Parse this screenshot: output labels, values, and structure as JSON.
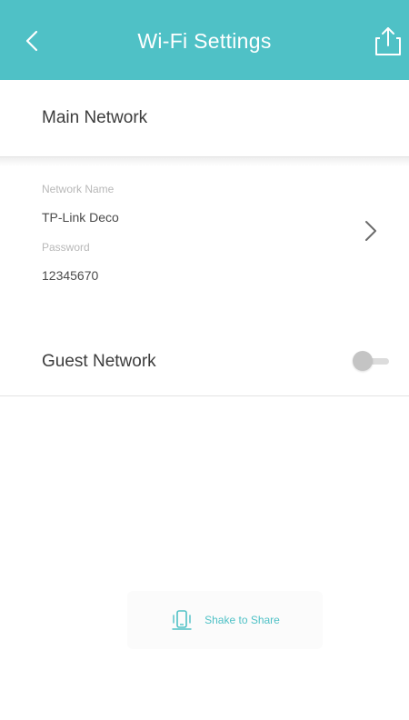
{
  "header": {
    "title": "Wi-Fi Settings",
    "back_icon": "chevron-left-icon",
    "share_icon": "share-icon",
    "color": "#4fc1c6"
  },
  "main_network": {
    "section_label": "Main Network",
    "network_name_label": "Network Name",
    "network_name_value": "TP-Link Deco",
    "password_label": "Password",
    "password_value": "12345670"
  },
  "guest_network": {
    "label": "Guest Network",
    "enabled": false
  },
  "shake": {
    "label": "Shake to Share",
    "icon": "shake-phone-icon"
  }
}
